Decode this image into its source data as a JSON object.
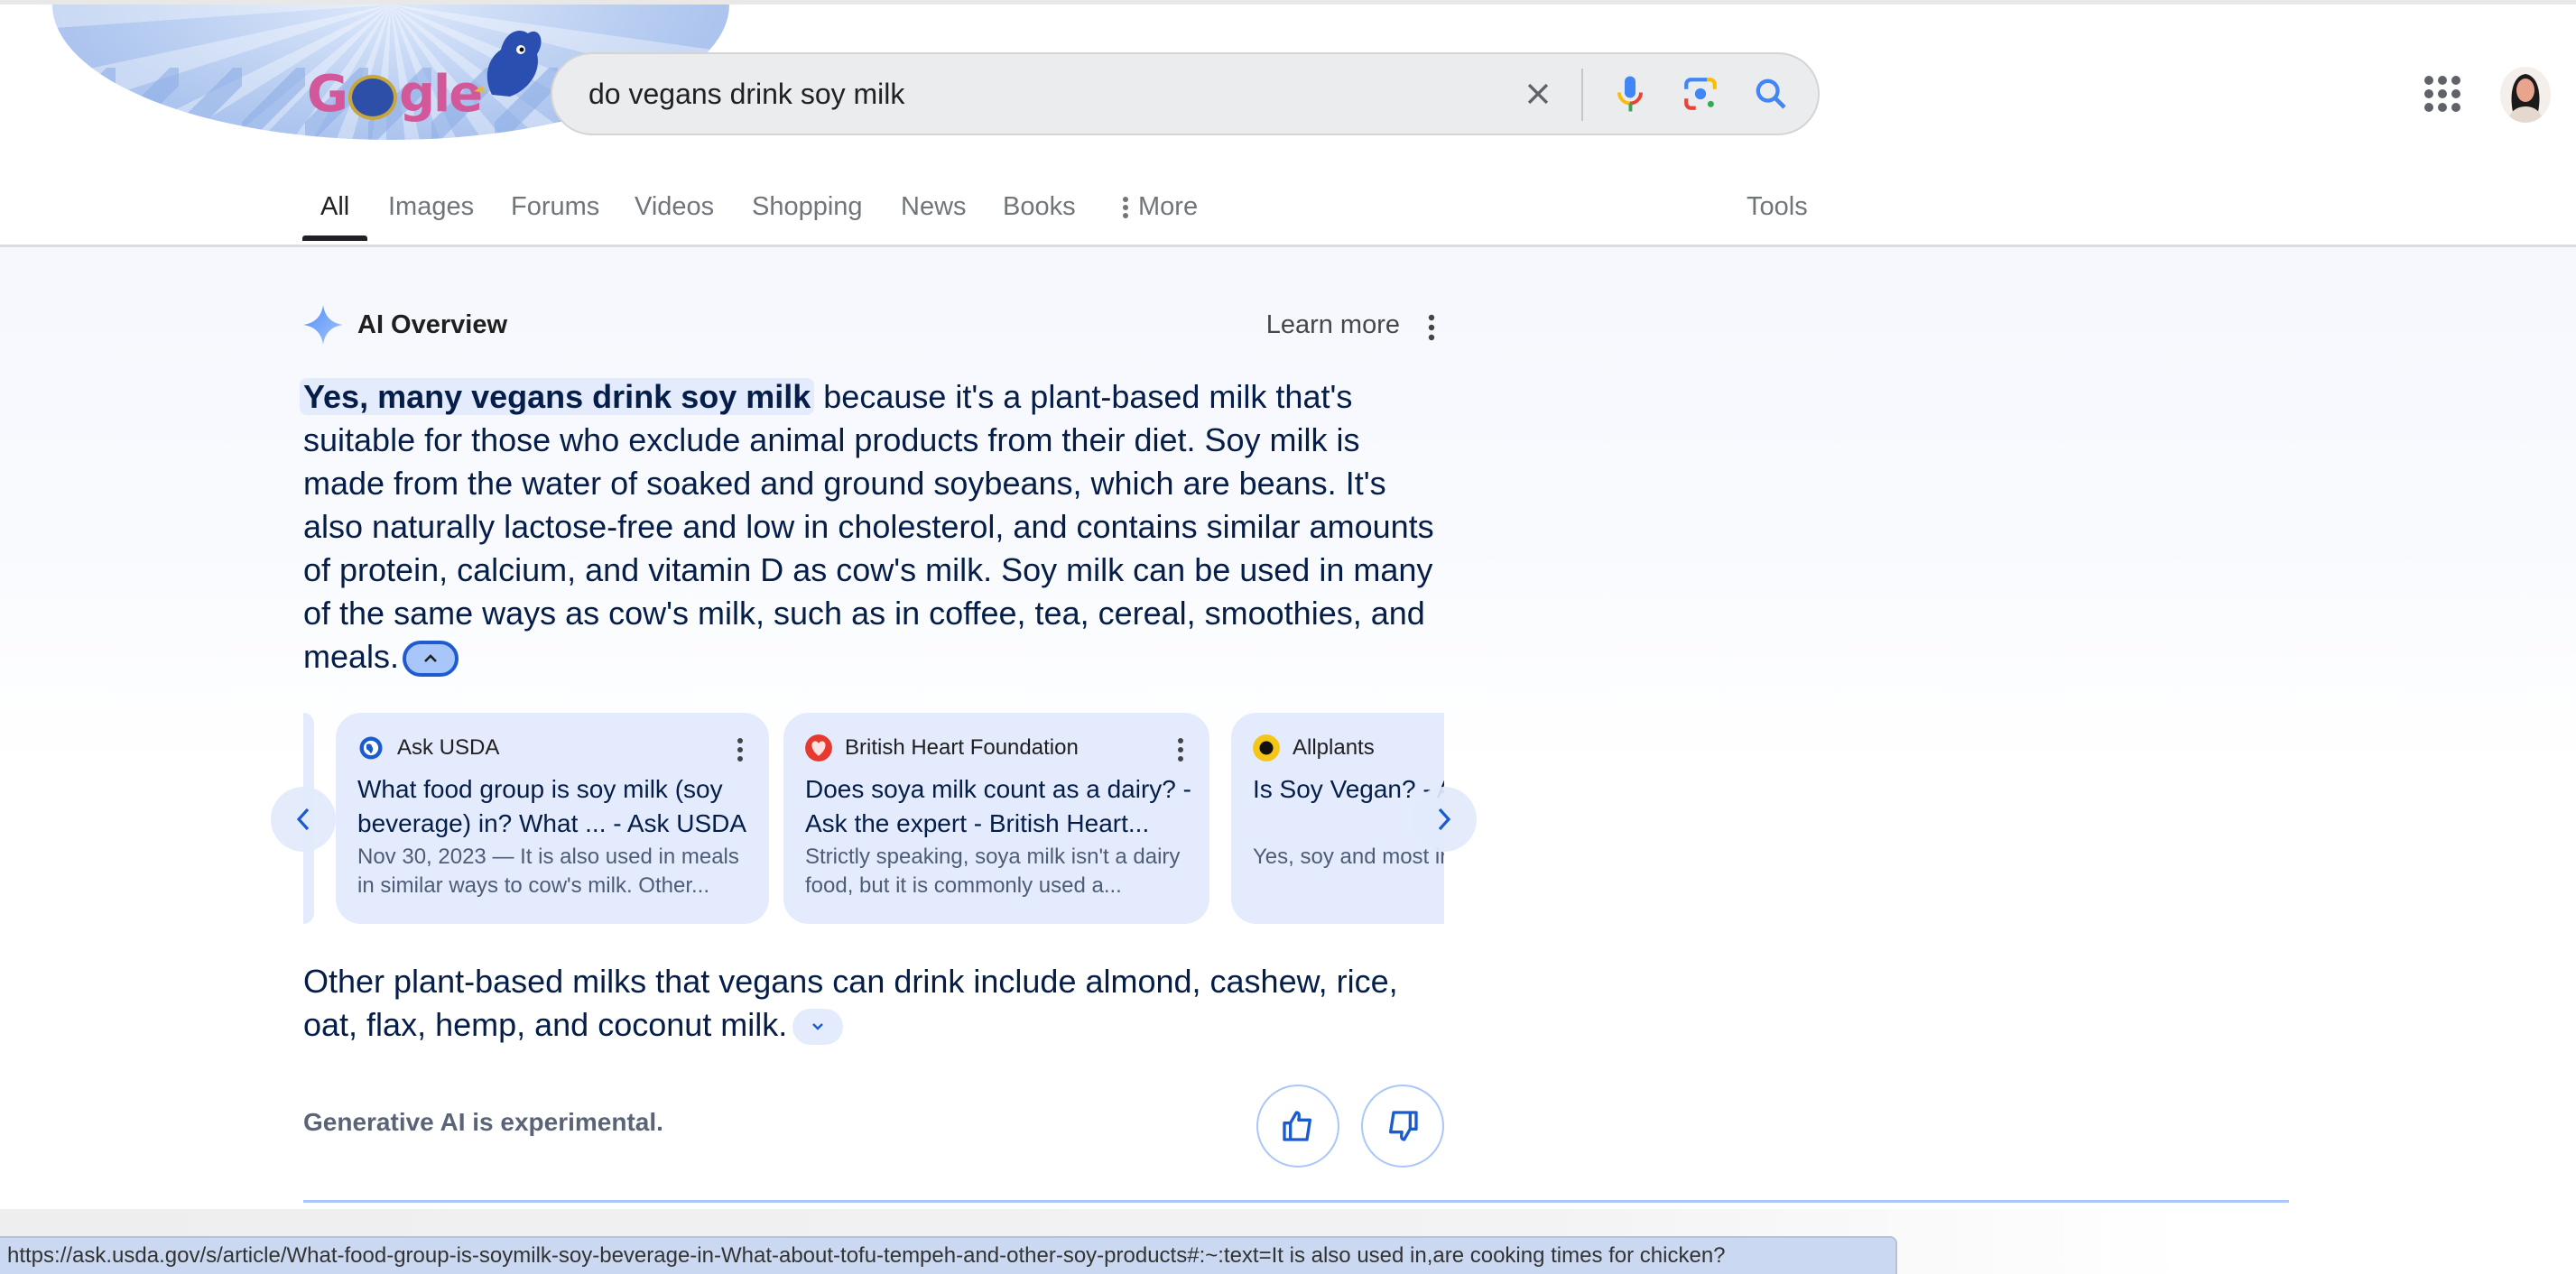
{
  "search": {
    "query": "do vegans drink soy milk",
    "logo_text": "Google",
    "clear_label": "Clear",
    "voice_label": "Search by voice",
    "lens_label": "Search by image",
    "search_label": "Search"
  },
  "header": {
    "apps_label": "Google apps",
    "account_label": "Google Account"
  },
  "tabs": [
    {
      "label": "All",
      "active": true
    },
    {
      "label": "Images"
    },
    {
      "label": "Forums"
    },
    {
      "label": "Videos"
    },
    {
      "label": "Shopping"
    },
    {
      "label": "News"
    },
    {
      "label": "Books"
    },
    {
      "label": "More",
      "icon": "kebab-vertical-icon"
    }
  ],
  "tools_label": "Tools",
  "ai_overview": {
    "title": "AI Overview",
    "learn_more": "Learn more",
    "highlight": "Yes, many vegans drink soy milk",
    "body": " because it's a plant-based milk that's suitable for those who exclude animal products from their diet. Soy milk is made from the water of soaked and ground soybeans, which are beans. It's also naturally lactose-free and low in cholesterol, and contains similar amounts of protein, calcium, and vitamin D as cow's milk. Soy milk can be used in many of the same ways as cow's milk, such as in coffee, tea, cereal, smoothies, and meals.",
    "sources": [
      {
        "site": "Ask USDA",
        "title": "What food group is soy milk (soy beverage) in? What ... - Ask USDA",
        "snippet": "Nov 30, 2023 — It is also used in meals in similar ways to cow's milk. Other..."
      },
      {
        "site": "British Heart Foundation",
        "title": "Does soya milk count as a dairy? - Ask the expert - British Heart...",
        "snippet": "Strictly speaking, soya milk isn't a dairy food, but it is commonly used a..."
      },
      {
        "site": "Allplants",
        "title": "Is Soy Vegan? - A",
        "snippet": "Yes, soy and most indeed vegan. This i"
      }
    ],
    "body2": "Other plant-based milks that vegans can drink include almond, cashew, rice, oat, flax, hemp, and coconut milk.",
    "disclaimer": "Generative AI is experimental.",
    "thumbs_up_label": "Good response",
    "thumbs_down_label": "Bad response"
  },
  "status_bar": {
    "url": "https://ask.usda.gov/s/article/What-food-group-is-soymilk-soy-beverage-in-What-about-tofu-tempeh-and-other-soy-products#:~:text=It is also used in,are cooking times for chicken?"
  },
  "colors": {
    "accent": "#1a5bd0",
    "card_bg": "#e4ebfd",
    "text_dark": "#041e49"
  }
}
